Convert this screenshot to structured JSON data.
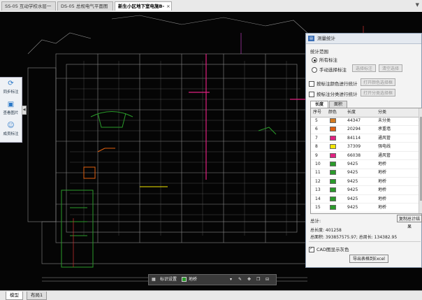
{
  "tabs": [
    {
      "label": "SS-05 互动学校水层一",
      "active": false
    },
    {
      "label": "DS-05 总规电气平面图",
      "active": false
    },
    {
      "label": "新生小区地下室电施B-",
      "active": true
    }
  ],
  "sidebar": {
    "items": [
      {
        "label": "同步标注",
        "icon": "sync-icon"
      },
      {
        "label": "查看图片",
        "icon": "image-icon"
      },
      {
        "label": "成员标注",
        "icon": "users-icon"
      }
    ]
  },
  "floatbar": {
    "label_a": "标识设置",
    "label_b": "地桥"
  },
  "panel": {
    "title": "测量统计",
    "scope_label": "统计范围",
    "radio_all": "所有标注",
    "radio_manual": "手动选择标注",
    "btn_select": "选择标注",
    "btn_clear": "清空选择",
    "chk_color": "按标注颜色进行统计",
    "btn_color": "打开颜色选择框",
    "chk_category": "按标注分类进行统计",
    "btn_category": "打开分类选择框",
    "tab_length": "长度",
    "tab_area": "面积",
    "columns": [
      "序号",
      "颜色",
      "长度",
      "分类"
    ],
    "rows": [
      {
        "no": "5",
        "color": "#d47a20",
        "length": "44347",
        "cat": "未分类"
      },
      {
        "no": "6",
        "color": "#e06010",
        "length": "20294",
        "cat": "承重墙"
      },
      {
        "no": "7",
        "color": "#e02080",
        "length": "84114",
        "cat": "通风管"
      },
      {
        "no": "8",
        "color": "#f2e600",
        "length": "37309",
        "cat": "强电线"
      },
      {
        "no": "9",
        "color": "#e02080",
        "length": "66038",
        "cat": "通风管"
      },
      {
        "no": "10",
        "color": "#2a9a2a",
        "length": "9425",
        "cat": "地桥"
      },
      {
        "no": "11",
        "color": "#2a9a2a",
        "length": "9425",
        "cat": "地桥"
      },
      {
        "no": "12",
        "color": "#2a9a2a",
        "length": "9425",
        "cat": "地桥"
      },
      {
        "no": "13",
        "color": "#2a9a2a",
        "length": "9425",
        "cat": "地桥"
      },
      {
        "no": "14",
        "color": "#2a9a2a",
        "length": "9425",
        "cat": "地桥"
      },
      {
        "no": "15",
        "color": "#2a9a2a",
        "length": "9425",
        "cat": "地桥"
      }
    ],
    "total_label": "总计:",
    "btn_copy": "复制总计结果",
    "total_length": "总长度: 401258",
    "total_area": "总面积: 393857575.97; 总周长: 134382.95",
    "chk_cad": "CAD图显示灰色",
    "btn_export": "导出表格到Excel"
  },
  "bottom_tabs": [
    "模型",
    "布局1"
  ]
}
